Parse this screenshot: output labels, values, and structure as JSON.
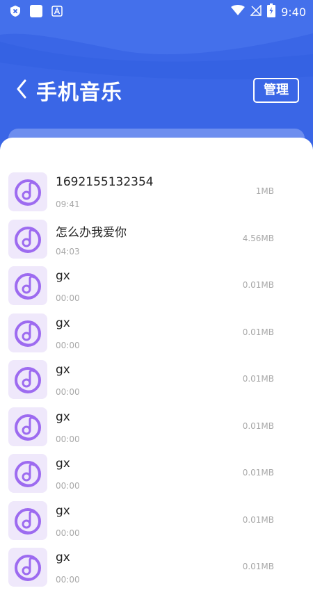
{
  "status_bar": {
    "time": "9:40",
    "left_icons": [
      "shield-icon",
      "square-icon",
      "font-app-icon"
    ],
    "right_icons": [
      "wifi-icon",
      "no-signal-icon",
      "battery-icon"
    ]
  },
  "header": {
    "title": "手机音乐",
    "manage_label": "管理",
    "back_icon": "chevron-left-icon"
  },
  "colors": {
    "header_blue": "#3a66e6",
    "thumb_bg": "#efe8fb",
    "thumb_icon": "#9d6bf0"
  },
  "songs": [
    {
      "name": "1692155132354",
      "time": "09:41",
      "size": "1MB"
    },
    {
      "name": "怎么办我爱你",
      "time": "04:03",
      "size": "4.56MB"
    },
    {
      "name": "gx",
      "time": "00:00",
      "size": "0.01MB"
    },
    {
      "name": "gx",
      "time": "00:00",
      "size": "0.01MB"
    },
    {
      "name": "gx",
      "time": "00:00",
      "size": "0.01MB"
    },
    {
      "name": "gx",
      "time": "00:00",
      "size": "0.01MB"
    },
    {
      "name": "gx",
      "time": "00:00",
      "size": "0.01MB"
    },
    {
      "name": "gx",
      "time": "00:00",
      "size": "0.01MB"
    },
    {
      "name": "gx",
      "time": "00:00",
      "size": "0.01MB"
    }
  ]
}
